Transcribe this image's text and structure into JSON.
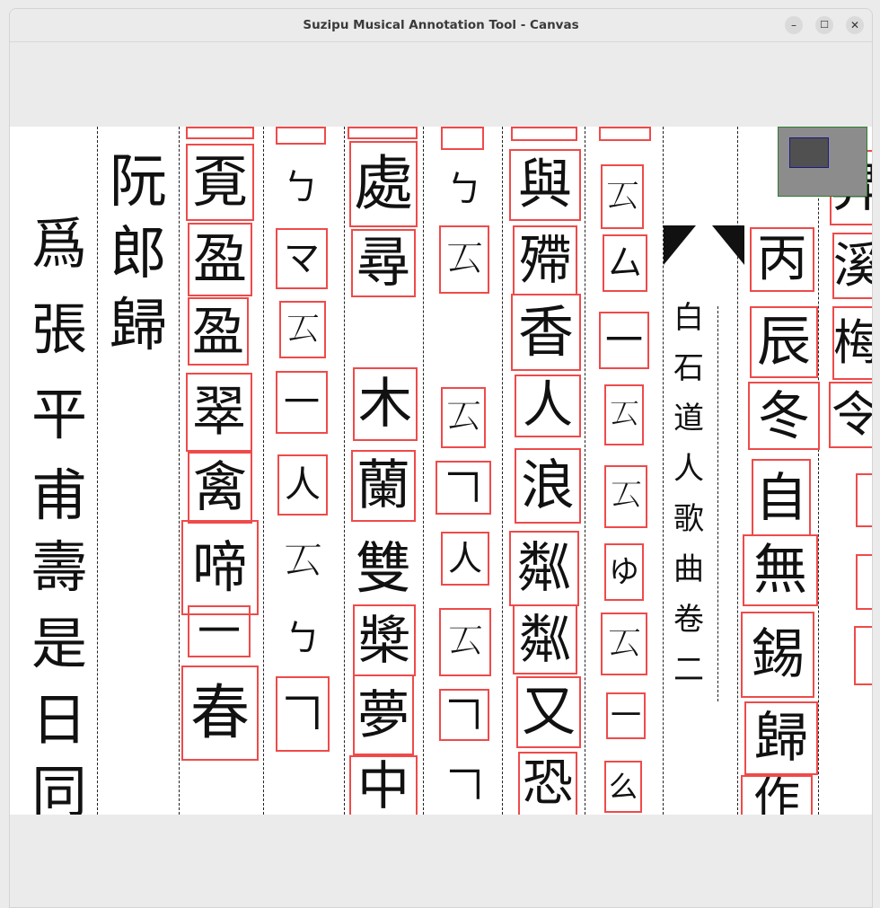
{
  "window": {
    "title": "Suzipu Musical Annotation Tool - Canvas"
  },
  "controls": {
    "minimize": "–",
    "maximize": "☐",
    "close": "✕"
  },
  "text_columns": {
    "col1": [
      "爲",
      "張",
      "平",
      "甫",
      "壽",
      "是",
      "日",
      "同"
    ],
    "col2": [
      "阮",
      "郎",
      "歸"
    ],
    "col_title": [
      "白",
      "石",
      "道",
      "人",
      "歌",
      "曲",
      "卷",
      "二"
    ]
  },
  "boxed_columns": {
    "c1": [
      "覔",
      "盈",
      "盈",
      "翠",
      "禽",
      "啼",
      "一",
      "春"
    ],
    "c2": [
      "𠃍",
      "マ",
      "𠫔",
      "一",
      "人",
      "𠃍"
    ],
    "c3": [
      "處",
      "尋",
      "木",
      "蘭",
      "雙",
      "槳",
      "夢",
      "中"
    ],
    "c4": [
      "𠃍",
      "𠫔",
      "𠫔",
      "𠃍",
      "人",
      "𠫔",
      "𠃍"
    ],
    "c5": [
      "與",
      "殢",
      "香",
      "人",
      "浪",
      "粼",
      "粼",
      "又",
      "恐"
    ],
    "c6": [
      "𠫔",
      "厶",
      "一",
      "𠫔",
      "𠫔",
      "ゆ",
      "𠫔",
      "一",
      "么"
    ],
    "c7": [
      "丙",
      "辰",
      "冬",
      "自",
      "無",
      "錫",
      "歸",
      "作"
    ],
    "c8": [
      "昇",
      "溪",
      "梅",
      "令"
    ]
  },
  "unboxed_notes": {
    "c2a": "ㄅ",
    "c2b": "𠫔",
    "c2c": "ㄅ",
    "c4a": "ㄅ",
    "c4b": "𠃍"
  },
  "colors": {
    "box": "#ef4a4a",
    "minimap_border": "#2e7d32",
    "viewport_border": "#1a1a8a"
  }
}
